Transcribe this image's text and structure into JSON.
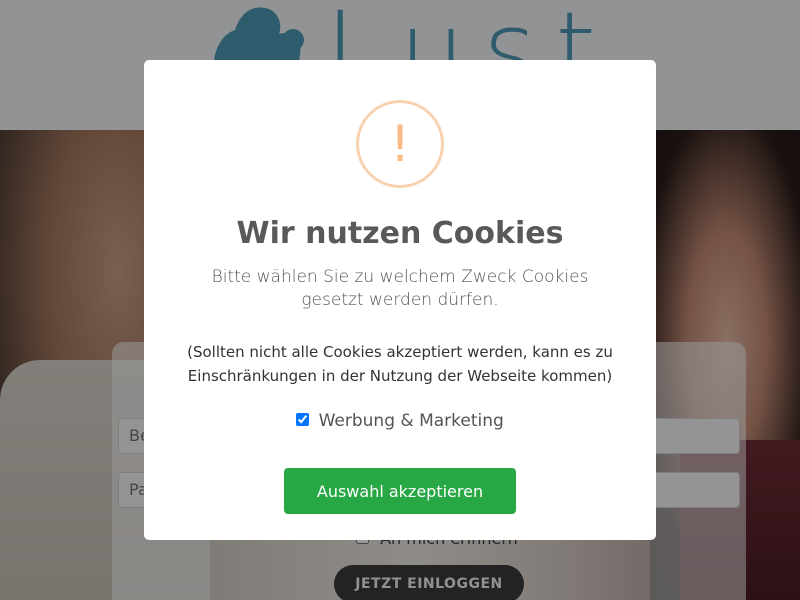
{
  "header": {
    "logo_text": "Lust"
  },
  "login": {
    "username_placeholder": "Be",
    "password_placeholder": "Pa",
    "remember_label": "An mich erinnern",
    "submit_label": "JETZT EINLOGGEN"
  },
  "cookie_dialog": {
    "icon": "warning-icon",
    "icon_glyph": "!",
    "title": "Wir nutzen Cookies",
    "text": "Bitte wählen Sie zu welchem Zweck Cookies gesetzt werden dürfen.",
    "note": "(Sollten nicht alle Cookies akzeptiert werden, kann es zu Einschränkungen in der Nutzung der Webseite kommen)",
    "consent_label": "Werbung & Marketing",
    "consent_checked": true,
    "accept_label": "Auswahl akzeptieren",
    "accept_color": "#28a745",
    "icon_color": "#f8bb86"
  }
}
